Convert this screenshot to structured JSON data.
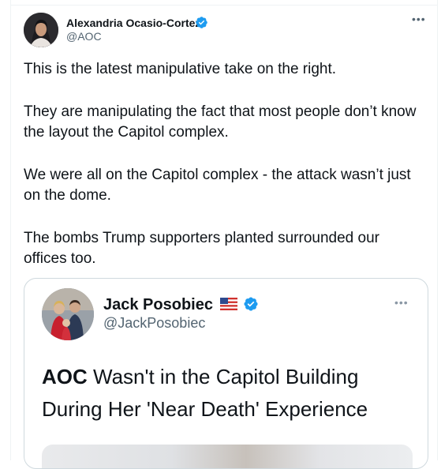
{
  "tweet": {
    "author_name": "Alexandria Ocasio-Cortez",
    "author_handle": "@AOC",
    "paragraphs": [
      "This is the latest manipulative take on the right.",
      "They are manipulating the fact that most people don’t know the layout the Capitol complex.",
      "We were all on the Capitol complex - the attack wasn’t just on the dome.",
      "The bombs Trump supporters planted surrounded our offices too."
    ]
  },
  "quoted": {
    "author_name": "Jack Posobiec",
    "author_handle": "@JackPosobiec",
    "headline_bold": "AOC",
    "headline_rest": " Wasn't in the Capitol Building During Her 'Near Death' Experience"
  },
  "icons": {
    "more": "more-horizontal-icon",
    "verified": "verified-badge-icon",
    "flag": "us-flag-icon"
  },
  "colors": {
    "verified_blue": "#1d9bf0",
    "text_primary": "#0f1419",
    "text_secondary": "#536471",
    "border": "#cfd9de"
  }
}
